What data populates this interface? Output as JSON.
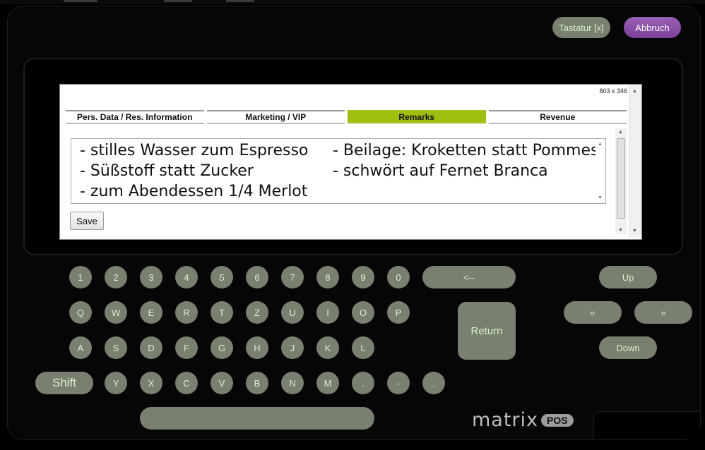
{
  "header": {
    "keyboard_button": "Tastatur [x]",
    "cancel_button": "Abbruch"
  },
  "browser": {
    "dimensions_label": "803 x 346",
    "tabs": [
      {
        "label": "Pers. Data / Res. Information",
        "active": false
      },
      {
        "label": "Marketing / VIP",
        "active": false
      },
      {
        "label": "Remarks",
        "active": true
      },
      {
        "label": "Revenue",
        "active": false
      }
    ],
    "remarks_lines": [
      "- stilles Wasser zum Espresso",
      "- Beilage: Kroketten statt Pommes",
      "- Süßstoff statt Zucker",
      "- schwört auf Fernet Branca",
      "- zum Abendessen 1/4 Merlot"
    ],
    "save_button": "Save",
    "active_tab_color": "#9fbf0f"
  },
  "keyboard": {
    "number_row": [
      "1",
      "2",
      "3",
      "4",
      "5",
      "6",
      "7",
      "8",
      "9",
      "0"
    ],
    "backspace": "<--",
    "row_q": [
      "Q",
      "W",
      "E",
      "R",
      "T",
      "Z",
      "U",
      "I",
      "O",
      "P"
    ],
    "row_a": [
      "A",
      "S",
      "D",
      "F",
      "G",
      "H",
      "J",
      "K",
      "L"
    ],
    "shift": "Shift",
    "row_y": [
      "Y",
      "X",
      "C",
      "V",
      "B",
      "N",
      "M",
      ".",
      "-",
      "."
    ],
    "return": "Return",
    "up": "Up",
    "prev": "«",
    "next": "»",
    "down": "Down",
    "key_color": "#7a8070",
    "key_text_color": "#d6f0c8"
  },
  "logo": {
    "word": "matrix",
    "badge": "POS"
  }
}
